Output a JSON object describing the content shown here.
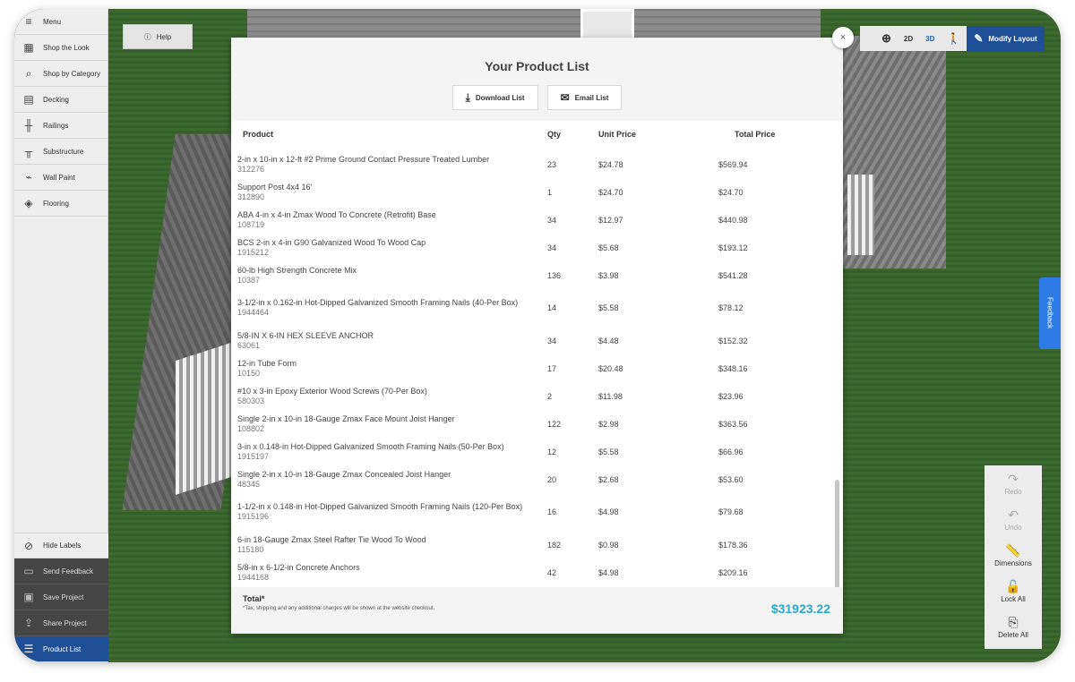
{
  "sidebar": {
    "items": [
      {
        "label": "Menu",
        "icon": "menu-icon",
        "glyph": "≡"
      },
      {
        "label": "Shop the Look",
        "icon": "shop-look-icon",
        "glyph": "▦"
      },
      {
        "label": "Shop by Category",
        "icon": "search-icon",
        "glyph": "⌕"
      },
      {
        "label": "Decking",
        "icon": "decking-icon",
        "glyph": "▤"
      },
      {
        "label": "Railings",
        "icon": "railing-icon",
        "glyph": "╫"
      },
      {
        "label": "Substructure",
        "icon": "substructure-icon",
        "glyph": "╥"
      },
      {
        "label": "Wall Paint",
        "icon": "paint-roller-icon",
        "glyph": "⌁"
      },
      {
        "label": "Flooring",
        "icon": "flooring-icon",
        "glyph": "◈"
      }
    ],
    "bottom": {
      "hide_labels": "Hide Labels",
      "send_feedback": "Send Feedback",
      "save_project": "Save Project",
      "share_project": "Share Project",
      "product_list": "Product List"
    }
  },
  "help": {
    "label": "Help"
  },
  "toolbar": {
    "view_2d": "2D",
    "view_3d": "3D",
    "modify_layout": "Modify Layout"
  },
  "feedback_tab": "Feedback",
  "actions": {
    "redo": "Redo",
    "undo": "Undo",
    "dimensions": "Dimensions",
    "lock_all": "Lock All",
    "delete_all": "Delete All"
  },
  "modal": {
    "title": "Your Product List",
    "download_label": "Download List",
    "email_label": "Email List",
    "columns": {
      "product": "Product",
      "qty": "Qty",
      "unit_price": "Unit Price",
      "total_price": "Total Price"
    },
    "rows": [
      {
        "name": "2-in x 10-in x 12-ft #2 Prime Ground Contact Pressure Treated Lumber",
        "sku": "312276",
        "qty": "23",
        "unit": "$24.78",
        "total": "$569.94"
      },
      {
        "name": "Support Post 4x4 16'",
        "sku": "312890",
        "qty": "1",
        "unit": "$24.70",
        "total": "$24.70"
      },
      {
        "name": "ABA 4-in x 4-in Zmax Wood To Concrete (Retrofit) Base",
        "sku": "108719",
        "qty": "34",
        "unit": "$12.97",
        "total": "$440.98"
      },
      {
        "name": "BCS 2-in x 4-in G90 Galvanized Wood To Wood Cap",
        "sku": "1915212",
        "qty": "34",
        "unit": "$5.68",
        "total": "$193.12"
      },
      {
        "name": "60-lb High Strength Concrete Mix",
        "sku": "10387",
        "qty": "136",
        "unit": "$3.98",
        "total": "$541.28"
      },
      {
        "name": "3-1/2-in x 0.162-in Hot-Dipped Galvanized Smooth Framing Nails (40-Per Box)",
        "sku": "1944464",
        "qty": "14",
        "unit": "$5.58",
        "total": "$78.12"
      },
      {
        "name": "5/8-IN X 6-IN HEX SLEEVE ANCHOR",
        "sku": "63061",
        "qty": "34",
        "unit": "$4.48",
        "total": "$152.32"
      },
      {
        "name": "12-in Tube Form",
        "sku": "10150",
        "qty": "17",
        "unit": "$20.48",
        "total": "$348.16"
      },
      {
        "name": "#10 x 3-in Epoxy Exterior Wood Screws (70-Per Box)",
        "sku": "580303",
        "qty": "2",
        "unit": "$11.98",
        "total": "$23.96"
      },
      {
        "name": "Single 2-in x 10-in 18-Gauge Zmax Face Mount Joist Hanger",
        "sku": "108802",
        "qty": "122",
        "unit": "$2.98",
        "total": "$363.56"
      },
      {
        "name": "3-in x 0.148-in Hot-Dipped Galvanized Smooth Framing Nails (50-Per Box)",
        "sku": "1915197",
        "qty": "12",
        "unit": "$5.58",
        "total": "$66.96"
      },
      {
        "name": "Single 2-in x 10-in 18-Gauge Zmax Concealed Joist Hanger",
        "sku": "48345",
        "qty": "20",
        "unit": "$2.68",
        "total": "$53.60"
      },
      {
        "name": "1-1/2-in x 0.148-in Hot-Dipped Galvanized Smooth Framing Nails (120-Per Box)",
        "sku": "1915196",
        "qty": "16",
        "unit": "$4.98",
        "total": "$79.68"
      },
      {
        "name": "6-in 18-Gauge Zmax Steel Rafter Tie Wood To Wood",
        "sku": "115180",
        "qty": "182",
        "unit": "$0.98",
        "total": "$178.36"
      },
      {
        "name": "5/8-in x 6-1/2-in Concrete Anchors",
        "sku": "1944168",
        "qty": "42",
        "unit": "$4.98",
        "total": "$209.16"
      }
    ],
    "total_label": "Total*",
    "total_note": "*Tax, shipping and any additional charges will be shown at the website checkout.",
    "total_value": "$31923.22"
  },
  "colors": {
    "accent": "#1e4f96",
    "total": "#2aa7c9",
    "feedback": "#2f7be5"
  }
}
